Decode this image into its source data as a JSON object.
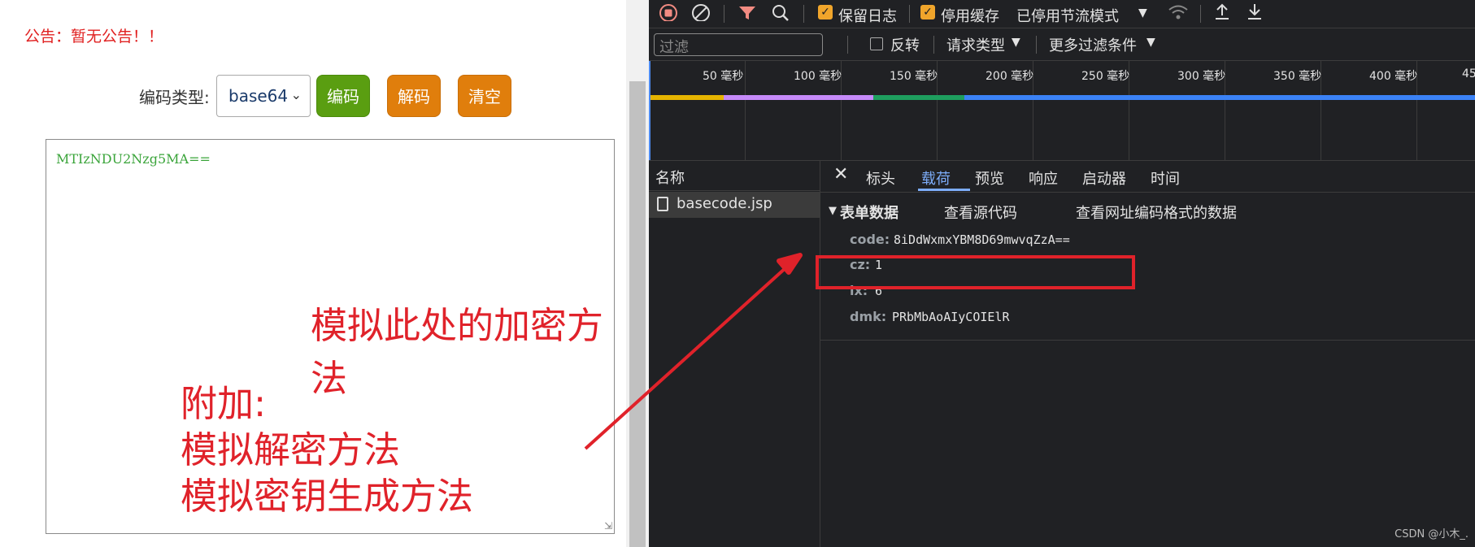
{
  "page": {
    "notice": "公告：暂无公告！！",
    "encode_type_label": "编码类型:",
    "encode_type_selected": "base64",
    "buttons": {
      "encode": "编码",
      "decode": "解码",
      "clear": "清空"
    },
    "textarea_value": "MTIzNDU2Nzg5MA=="
  },
  "annotations": {
    "main": "模拟此处的加密方法",
    "extra": "附加:\n模拟解密方法\n模拟密钥生成方法"
  },
  "devtools": {
    "toolbar": {
      "preserve_log": "保留日志",
      "disable_cache": "停用缓存",
      "throttle": "已停用节流模式"
    },
    "filter": {
      "placeholder": "过滤",
      "invert": "反转",
      "request_types": "请求类型",
      "more_filters": "更多过滤条件"
    },
    "timeline_ticks": [
      "50 毫秒",
      "100 毫秒",
      "150 毫秒",
      "200 毫秒",
      "250 毫秒",
      "300 毫秒",
      "350 毫秒",
      "400 毫秒",
      "45"
    ],
    "name_column": {
      "header": "名称",
      "requests": [
        "basecode.jsp"
      ]
    },
    "tabs": [
      "标头",
      "载荷",
      "预览",
      "响应",
      "启动器",
      "时间"
    ],
    "active_tab": "载荷",
    "payload": {
      "section_title": "表单数据",
      "view_source": "查看源代码",
      "view_url_encoded": "查看网址编码格式的数据",
      "fields": [
        {
          "key": "code:",
          "value": "8iDdWxmxYBM8D69mwvqZzA=="
        },
        {
          "key": "cz:",
          "value": "1"
        },
        {
          "key": "lx:",
          "value": "6"
        },
        {
          "key": "dmk:",
          "value": "PRbMbAoAIyCOIElR"
        }
      ]
    },
    "watermark": "CSDN @小木_."
  },
  "colors": {
    "devtools_bg": "#202124",
    "annotation": "#e0222a",
    "encode_btn": "#5a9e11",
    "orange_btn": "#e07e0c",
    "timeline_bars": [
      "#e6b400",
      "#c58af9",
      "#1e9e5e",
      "#3b82f6"
    ]
  },
  "icons": [
    "stop-recording-icon",
    "clear-icon",
    "filter-icon",
    "search-icon",
    "wifi-icon",
    "upload-icon",
    "download-icon",
    "file-icon",
    "close-icon",
    "chevron-down-icon"
  ]
}
